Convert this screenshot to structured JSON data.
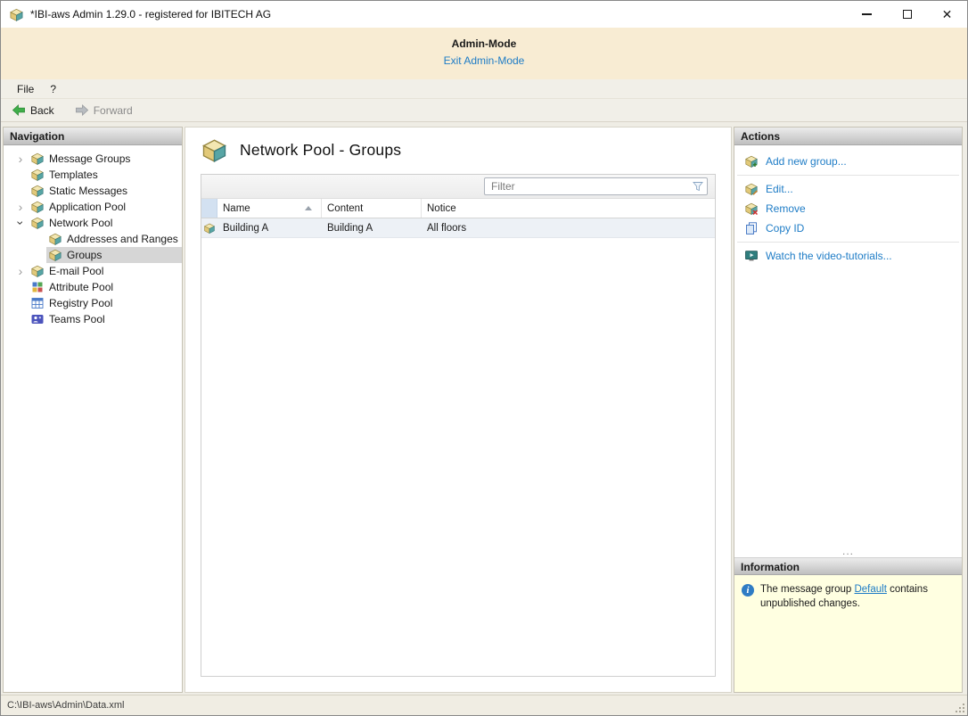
{
  "window": {
    "title": "*IBI-aws Admin 1.29.0 - registered for IBITECH AG"
  },
  "admin_banner": {
    "title": "Admin-Mode",
    "exit_link": "Exit Admin-Mode"
  },
  "menu_bar": {
    "items": [
      "File",
      "?"
    ]
  },
  "toolbar": {
    "back_label": "Back",
    "forward_label": "Forward"
  },
  "navigation": {
    "header": "Navigation",
    "items": [
      {
        "label": "Message Groups",
        "icon": "box-icon",
        "state": "collapsed",
        "level": 1
      },
      {
        "label": "Templates",
        "icon": "box-icon",
        "state": "none",
        "level": 1
      },
      {
        "label": "Static Messages",
        "icon": "box-icon",
        "state": "none",
        "level": 1
      },
      {
        "label": "Application Pool",
        "icon": "box-icon",
        "state": "collapsed",
        "level": 1
      },
      {
        "label": "Network Pool",
        "icon": "box-icon",
        "state": "expanded",
        "level": 1
      },
      {
        "label": "Addresses and Ranges",
        "icon": "box-icon",
        "state": "none",
        "level": 2
      },
      {
        "label": "Groups",
        "icon": "box-icon",
        "state": "none",
        "level": 2,
        "selected": true
      },
      {
        "label": "E-mail Pool",
        "icon": "box-icon",
        "state": "collapsed",
        "level": 1
      },
      {
        "label": "Attribute Pool",
        "icon": "attribute-grid-icon",
        "state": "none",
        "level": 1
      },
      {
        "label": "Registry Pool",
        "icon": "registry-grid-icon",
        "state": "none",
        "level": 1
      },
      {
        "label": "Teams Pool",
        "icon": "teams-icon",
        "state": "none",
        "level": 1
      }
    ]
  },
  "main": {
    "title": "Network Pool - Groups",
    "filter": {
      "placeholder": "Filter"
    },
    "table": {
      "columns": [
        "Name",
        "Content",
        "Notice"
      ],
      "sort": {
        "column": "Name",
        "direction": "ascending"
      },
      "rows": [
        {
          "name": "Building A",
          "content": "Building A",
          "notice": "All floors"
        }
      ]
    }
  },
  "actions": {
    "header": "Actions",
    "items": [
      {
        "label": "Add new group...",
        "icon": "box-add-icon"
      },
      {
        "label": "Edit...",
        "icon": "box-edit-icon"
      },
      {
        "label": "Remove",
        "icon": "box-remove-icon"
      },
      {
        "label": "Copy ID",
        "icon": "copy-icon"
      },
      {
        "label": "Watch the video-tutorials...",
        "icon": "video-icon"
      }
    ],
    "overflow": "..."
  },
  "information": {
    "header": "Information",
    "message": {
      "prefix": "The message group ",
      "link": "Default",
      "suffix": " contains unpublished changes."
    }
  },
  "status_bar": {
    "path": "C:\\IBI-aws\\Admin\\Data.xml"
  },
  "colors": {
    "banner_bg": "#f8ecd3",
    "link_blue": "#1e7cc6",
    "info_bg": "#ffffe1",
    "selection_bg": "#d6d6d6",
    "row_bg": "#edf1f6"
  }
}
